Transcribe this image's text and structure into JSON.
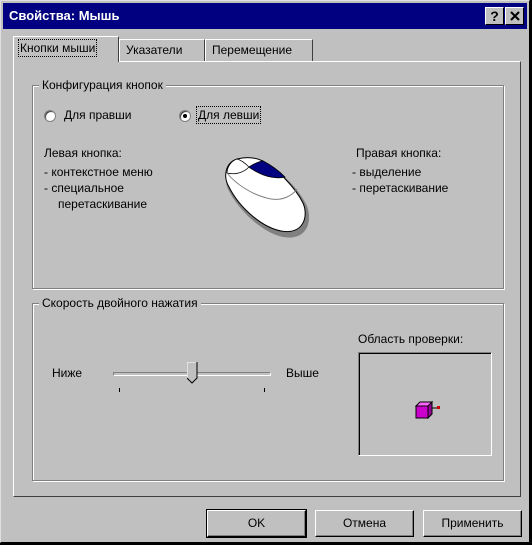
{
  "window": {
    "title": "Свойства: Мышь",
    "help_glyph": "?",
    "close_glyph": "✕"
  },
  "tabs": [
    {
      "label": "Кнопки мыши",
      "active": true
    },
    {
      "label": "Указатели",
      "active": false
    },
    {
      "label": "Перемещение",
      "active": false
    }
  ],
  "button_config": {
    "legend": "Конфигурация кнопок",
    "right_handed": "Для правши",
    "left_handed": "Для левши",
    "selected": "left_handed",
    "left_button_title": "Левая кнопка:",
    "left_button_items": [
      "- контекстное меню",
      "- специальное",
      "перетаскивание"
    ],
    "right_button_title": "Правая кнопка:",
    "right_button_items": [
      "- выделение",
      "- перетаскивание"
    ]
  },
  "double_click": {
    "legend": "Скорость двойного нажатия",
    "slow_label": "Ниже",
    "fast_label": "Выше",
    "slider_value": 0.5,
    "test_area_label": "Область проверки:"
  },
  "buttons": {
    "ok": "OK",
    "cancel": "Отмена",
    "apply": "Применить"
  },
  "colors": {
    "title_bar": "#000080",
    "face": "#c0c0c0",
    "box_accent": "#cc00cc"
  }
}
